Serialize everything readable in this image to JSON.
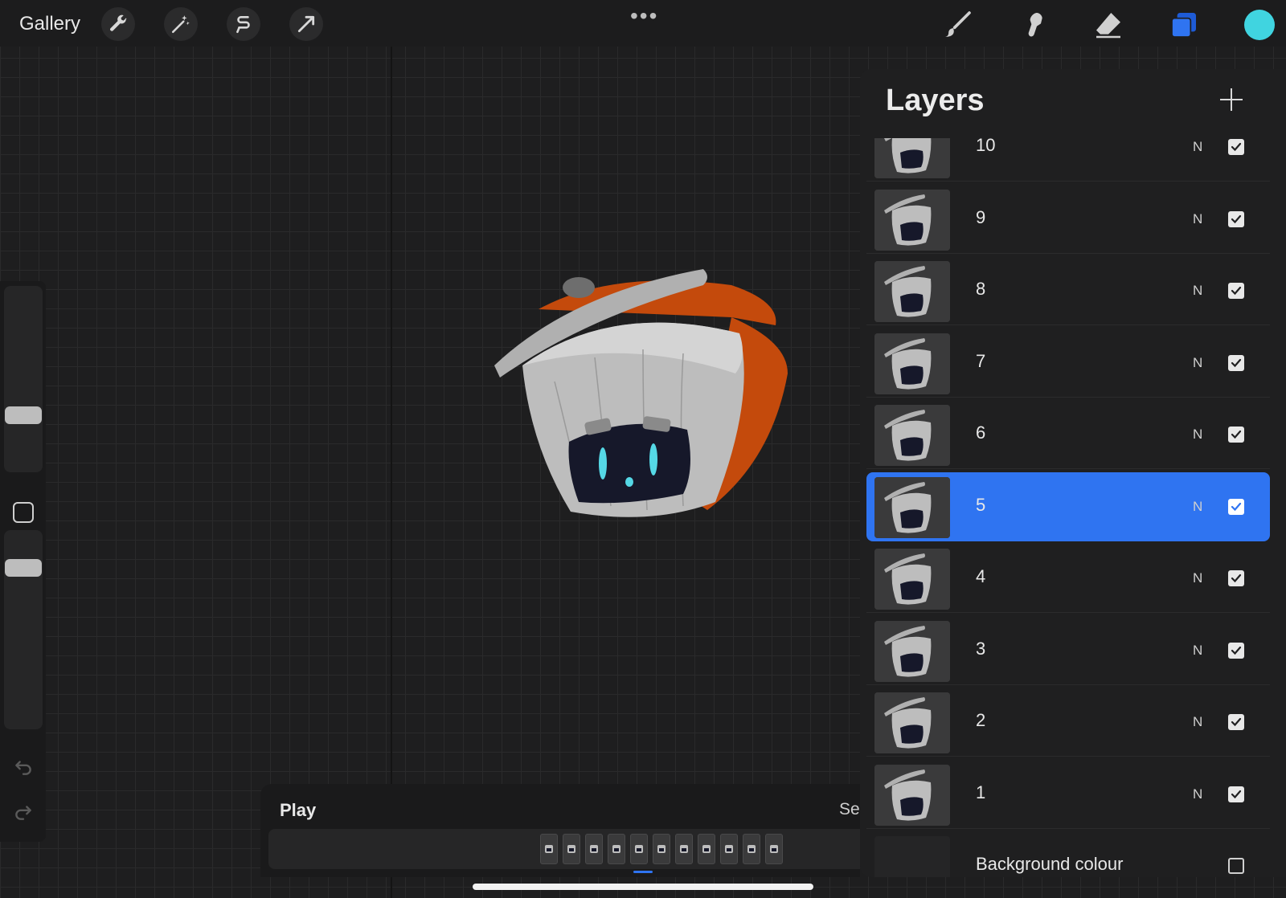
{
  "toolbar": {
    "gallery_label": "Gallery",
    "left_tools": [
      "wrench-icon",
      "magic-wand-icon",
      "selection-icon",
      "transform-arrow-icon"
    ],
    "more_label": "•••",
    "right_tools": [
      "brush-icon",
      "smudge-icon",
      "eraser-icon",
      "layers-icon"
    ],
    "active_color": "#40d4e0"
  },
  "layers": {
    "title": "Layers",
    "items": [
      {
        "label": "10",
        "blend": "N",
        "visible": true
      },
      {
        "label": "9",
        "blend": "N",
        "visible": true
      },
      {
        "label": "8",
        "blend": "N",
        "visible": true
      },
      {
        "label": "7",
        "blend": "N",
        "visible": true
      },
      {
        "label": "6",
        "blend": "N",
        "visible": true
      },
      {
        "label": "5",
        "blend": "N",
        "visible": true,
        "selected": true
      },
      {
        "label": "4",
        "blend": "N",
        "visible": true
      },
      {
        "label": "3",
        "blend": "N",
        "visible": true
      },
      {
        "label": "2",
        "blend": "N",
        "visible": true
      },
      {
        "label": "1",
        "blend": "N",
        "visible": true
      }
    ],
    "background": {
      "label": "Background colour",
      "visible": false
    },
    "selection_color": "#2f74f1"
  },
  "timeline": {
    "play_label": "Play",
    "settings_label": "Se",
    "frame_count": 11
  }
}
